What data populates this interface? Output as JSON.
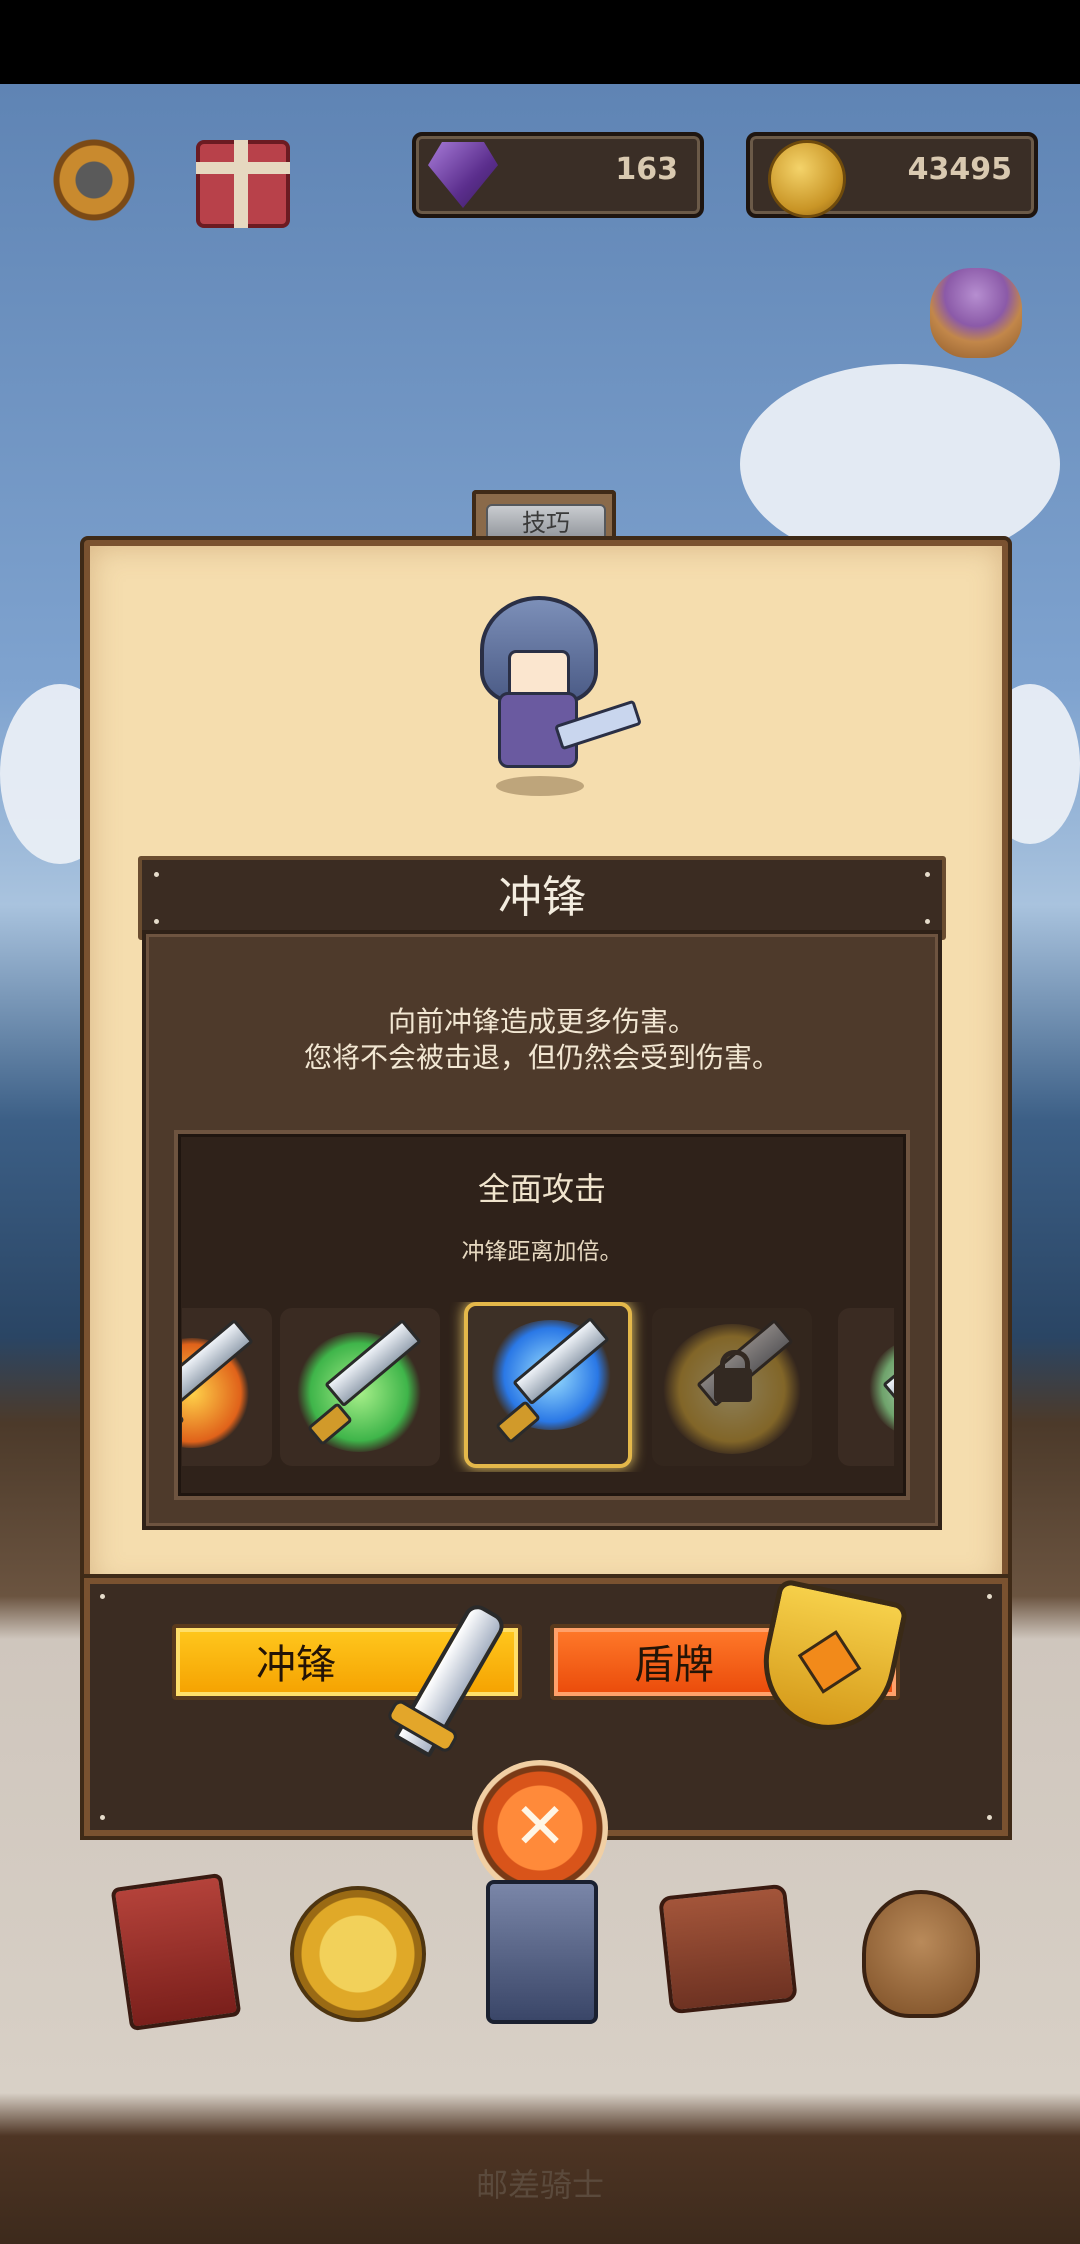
{
  "top_bar": {
    "gems": "163",
    "coins": "43495",
    "icons": [
      "gear-icon",
      "gift-icon",
      "gem-icon",
      "coin-icon",
      "loot-sack-icon"
    ]
  },
  "panel": {
    "tab_label": "技巧",
    "skill_name": "冲锋",
    "description_line1": "向前冲锋造成更多伤害。",
    "description_line2": "您将不会被击退，但仍然会受到伤害。",
    "upgrade": {
      "title": "全面攻击",
      "description": "冲锋距离加倍。",
      "options": [
        {
          "icon": "fire-sword-icon",
          "state": "partial"
        },
        {
          "icon": "heal-sword-icon",
          "state": "available"
        },
        {
          "icon": "wind-sword-icon",
          "state": "selected"
        },
        {
          "icon": "burst-sword-icon",
          "state": "locked"
        },
        {
          "icon": "arrow-sword-icon",
          "state": "partial"
        }
      ]
    }
  },
  "actions": {
    "charge_label": "冲锋",
    "shield_label": "盾牌"
  },
  "bottom_menu": {
    "icons": [
      "spellbook-icon",
      "star-coin-icon",
      "card-deck-icon",
      "inventory-bag-icon",
      "loot-bag-icon"
    ]
  },
  "footer": {
    "title": "邮差骑士"
  },
  "colors": {
    "panel_bg": "#f5ddae",
    "dark_wood": "#3b2c22",
    "charge_button": "#ffc81e",
    "shield_button": "#ff7a2a",
    "selected_glow": "#e4b84a"
  }
}
